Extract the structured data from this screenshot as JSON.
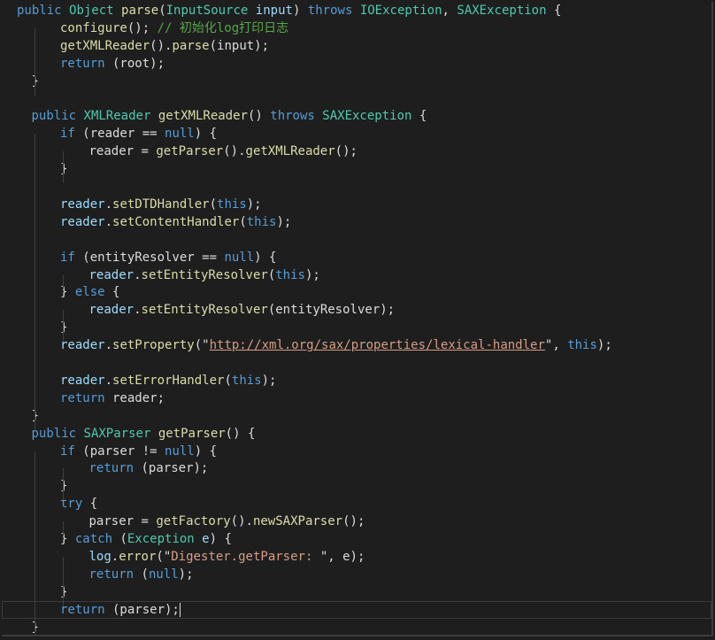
{
  "editor": {
    "lines": [
      {
        "indent": 0,
        "tokens": [
          {
            "t": "public",
            "c": "kw"
          },
          {
            "t": " "
          },
          {
            "t": "Object",
            "c": "ty"
          },
          {
            "t": " "
          },
          {
            "t": "parse",
            "c": "fn"
          },
          {
            "t": "("
          },
          {
            "t": "InputSource",
            "c": "ty"
          },
          {
            "t": " "
          },
          {
            "t": "input",
            "c": "pm"
          },
          {
            "t": ") "
          },
          {
            "t": "throws",
            "c": "kw"
          },
          {
            "t": " "
          },
          {
            "t": "IOException",
            "c": "ty"
          },
          {
            "t": ", "
          },
          {
            "t": "SAXException",
            "c": "ty"
          },
          {
            "t": " {"
          }
        ]
      },
      {
        "indent": 2,
        "tokens": [
          {
            "t": "configure",
            "c": "fn"
          },
          {
            "t": "(); "
          },
          {
            "t": "// 初始化log打印日志",
            "c": "cm"
          }
        ]
      },
      {
        "indent": 2,
        "tokens": [
          {
            "t": "getXMLReader",
            "c": "fn"
          },
          {
            "t": "()."
          },
          {
            "t": "parse",
            "c": "fn"
          },
          {
            "t": "(input);"
          }
        ]
      },
      {
        "indent": 2,
        "tokens": [
          {
            "t": "return",
            "c": "kw"
          },
          {
            "t": " (root);"
          }
        ]
      },
      {
        "indent": 1,
        "tokens": [
          {
            "t": "}"
          }
        ]
      },
      {
        "indent": 0,
        "tokens": []
      },
      {
        "indent": 1,
        "tokens": [
          {
            "t": "public",
            "c": "kw"
          },
          {
            "t": " "
          },
          {
            "t": "XMLReader",
            "c": "ty"
          },
          {
            "t": " "
          },
          {
            "t": "getXMLReader",
            "c": "fn"
          },
          {
            "t": "() "
          },
          {
            "t": "throws",
            "c": "kw"
          },
          {
            "t": " "
          },
          {
            "t": "SAXException",
            "c": "ty"
          },
          {
            "t": " {"
          }
        ]
      },
      {
        "indent": 2,
        "tokens": [
          {
            "t": "if",
            "c": "kw"
          },
          {
            "t": " (reader == "
          },
          {
            "t": "null",
            "c": "kw"
          },
          {
            "t": ") {"
          }
        ]
      },
      {
        "indent": 3,
        "tokens": [
          {
            "t": "reader = "
          },
          {
            "t": "getParser",
            "c": "fn"
          },
          {
            "t": "()."
          },
          {
            "t": "getXMLReader",
            "c": "fn"
          },
          {
            "t": "();"
          }
        ]
      },
      {
        "indent": 2,
        "tokens": [
          {
            "t": "}"
          }
        ]
      },
      {
        "indent": 0,
        "tokens": []
      },
      {
        "indent": 2,
        "tokens": [
          {
            "t": "reader",
            "c": "pm"
          },
          {
            "t": "."
          },
          {
            "t": "setDTDHandler",
            "c": "fn"
          },
          {
            "t": "("
          },
          {
            "t": "this",
            "c": "kw"
          },
          {
            "t": ");"
          }
        ]
      },
      {
        "indent": 2,
        "tokens": [
          {
            "t": "reader",
            "c": "pm"
          },
          {
            "t": "."
          },
          {
            "t": "setContentHandler",
            "c": "fn"
          },
          {
            "t": "("
          },
          {
            "t": "this",
            "c": "kw"
          },
          {
            "t": ");"
          }
        ]
      },
      {
        "indent": 0,
        "tokens": []
      },
      {
        "indent": 2,
        "tokens": [
          {
            "t": "if",
            "c": "kw"
          },
          {
            "t": " (entityResolver == "
          },
          {
            "t": "null",
            "c": "kw"
          },
          {
            "t": ") {"
          }
        ]
      },
      {
        "indent": 3,
        "tokens": [
          {
            "t": "reader",
            "c": "pm"
          },
          {
            "t": "."
          },
          {
            "t": "setEntityResolver",
            "c": "fn"
          },
          {
            "t": "("
          },
          {
            "t": "this",
            "c": "kw"
          },
          {
            "t": ");"
          }
        ]
      },
      {
        "indent": 2,
        "tokens": [
          {
            "t": "} "
          },
          {
            "t": "else",
            "c": "kw"
          },
          {
            "t": " {"
          }
        ]
      },
      {
        "indent": 3,
        "tokens": [
          {
            "t": "reader",
            "c": "pm"
          },
          {
            "t": "."
          },
          {
            "t": "setEntityResolver",
            "c": "fn"
          },
          {
            "t": "(entityResolver);"
          }
        ]
      },
      {
        "indent": 2,
        "tokens": [
          {
            "t": "}"
          }
        ]
      },
      {
        "indent": 2,
        "tokens": [
          {
            "t": "reader",
            "c": "pm"
          },
          {
            "t": "."
          },
          {
            "t": "setProperty",
            "c": "fn"
          },
          {
            "t": "(\""
          },
          {
            "t": "http://xml.org/sax/properties/lexical-handler",
            "c": "url"
          },
          {
            "t": "\", "
          },
          {
            "t": "this",
            "c": "kw"
          },
          {
            "t": ");"
          }
        ]
      },
      {
        "indent": 0,
        "tokens": []
      },
      {
        "indent": 2,
        "tokens": [
          {
            "t": "reader",
            "c": "pm"
          },
          {
            "t": "."
          },
          {
            "t": "setErrorHandler",
            "c": "fn"
          },
          {
            "t": "("
          },
          {
            "t": "this",
            "c": "kw"
          },
          {
            "t": ");"
          }
        ]
      },
      {
        "indent": 2,
        "tokens": [
          {
            "t": "return",
            "c": "kw"
          },
          {
            "t": " reader;"
          }
        ]
      },
      {
        "indent": 1,
        "tokens": [
          {
            "t": "}"
          }
        ]
      },
      {
        "indent": 1,
        "tokens": [
          {
            "t": "public",
            "c": "kw"
          },
          {
            "t": " "
          },
          {
            "t": "SAXParser",
            "c": "ty"
          },
          {
            "t": " "
          },
          {
            "t": "getParser",
            "c": "fn"
          },
          {
            "t": "() {"
          }
        ]
      },
      {
        "indent": 2,
        "tokens": [
          {
            "t": "if",
            "c": "kw"
          },
          {
            "t": " (parser != "
          },
          {
            "t": "null",
            "c": "kw"
          },
          {
            "t": ") {"
          }
        ]
      },
      {
        "indent": 3,
        "tokens": [
          {
            "t": "return",
            "c": "kw"
          },
          {
            "t": " (parser);"
          }
        ]
      },
      {
        "indent": 2,
        "tokens": [
          {
            "t": "}"
          }
        ]
      },
      {
        "indent": 2,
        "tokens": [
          {
            "t": "try",
            "c": "kw"
          },
          {
            "t": " {"
          }
        ]
      },
      {
        "indent": 3,
        "tokens": [
          {
            "t": "parser = "
          },
          {
            "t": "getFactory",
            "c": "fn"
          },
          {
            "t": "()."
          },
          {
            "t": "newSAXParser",
            "c": "fn"
          },
          {
            "t": "();"
          }
        ]
      },
      {
        "indent": 2,
        "tokens": [
          {
            "t": "} "
          },
          {
            "t": "catch",
            "c": "kw"
          },
          {
            "t": " ("
          },
          {
            "t": "Exception",
            "c": "ty"
          },
          {
            "t": " "
          },
          {
            "t": "e",
            "c": "pm"
          },
          {
            "t": ") {"
          }
        ]
      },
      {
        "indent": 3,
        "tokens": [
          {
            "t": "log",
            "c": "pm"
          },
          {
            "t": "."
          },
          {
            "t": "error",
            "c": "fn"
          },
          {
            "t": "(\""
          },
          {
            "t": "Digester.getParser: ",
            "c": "st"
          },
          {
            "t": "\", e);"
          }
        ]
      },
      {
        "indent": 3,
        "tokens": [
          {
            "t": "return",
            "c": "kw"
          },
          {
            "t": " ("
          },
          {
            "t": "null",
            "c": "kw"
          },
          {
            "t": ");"
          }
        ]
      },
      {
        "indent": 2,
        "tokens": [
          {
            "t": "}"
          }
        ]
      },
      {
        "indent": 2,
        "current": true,
        "tokens": [
          {
            "t": "return",
            "c": "kw"
          },
          {
            "t": " (parser);"
          }
        ]
      },
      {
        "indent": 1,
        "tokens": [
          {
            "t": "}"
          }
        ]
      }
    ]
  }
}
